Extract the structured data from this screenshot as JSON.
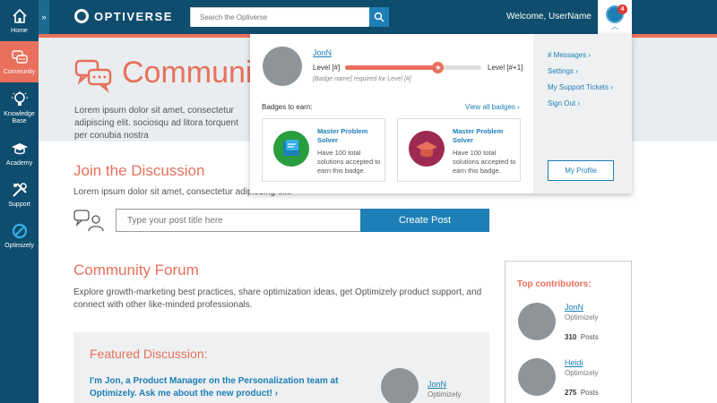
{
  "nav": {
    "items": [
      {
        "label": "Home",
        "icon": "home-icon"
      },
      {
        "label": "Community",
        "icon": "chat-bubbles-icon",
        "active": true
      },
      {
        "label": "Knowledge Base",
        "icon": "lightbulb-icon"
      },
      {
        "label": "Academy",
        "icon": "graduation-cap-icon"
      },
      {
        "label": "Support",
        "icon": "tools-icon"
      },
      {
        "label": "Optimizely",
        "icon": "optimizely-logo-icon"
      }
    ],
    "collapse_glyph": "»"
  },
  "header": {
    "logo_text": "OPTIVERSE",
    "search_placeholder": "Search the Optiverse",
    "welcome": "Welcome, UserName",
    "notification_count": "4"
  },
  "hero": {
    "title": "Community",
    "text": "Lorem ipsum dolor sit amet, consectetur adipiscing elit. sociosqu ad litora torquent per conubia nostra"
  },
  "join": {
    "title": "Join the Discussion",
    "text": "Lorem ipsum dolor sit amet, consectetur adipiscing elit.",
    "post_placeholder": "Type your post title here",
    "post_button": "Create Post"
  },
  "forum": {
    "title": "Community Forum",
    "text": "Explore growth-marketing best practices, share optimization ideas, get Optimizely product support, and connect with other like-minded professionals."
  },
  "featured": {
    "title": "Featured Discussion:",
    "link": "I'm Jon, a Product Manager on the Personalization team at Optimizely. Ask me about the new product! ›",
    "user": "JonN",
    "org": "Optimizely"
  },
  "contributors": {
    "title": "Top contributors:",
    "posts_label": "Posts",
    "items": [
      {
        "name": "JonN",
        "org": "Optimizely",
        "posts": "310"
      },
      {
        "name": "Heidi",
        "org": "Optimizely",
        "posts": "275"
      }
    ]
  },
  "dropdown": {
    "username": "JonN",
    "level_current": "Level [#]",
    "level_next": "Level [#+1]",
    "level_progress": 0.68,
    "level_requirement": "[Badge name] required for Level [#]",
    "badges_label": "Badges to earn:",
    "view_all": "View all badges ›",
    "badges": [
      {
        "name": "Master Problem Solver",
        "desc": "Have 100 total solutions accepted to earn this badge.",
        "color": "#2a9d3f",
        "icon": "document-badge-icon"
      },
      {
        "name": "Master Problem Solver",
        "desc": "Have 100 total solutions accepted to earn this badge.",
        "color": "#9c2a52",
        "icon": "graduation-cap-badge-icon"
      }
    ],
    "links": [
      "# Messages ›",
      "Settings ›",
      "My Support Tickets ›",
      "Sign Out ›"
    ],
    "profile_button": "My Profile"
  },
  "colors": {
    "nav_bg": "#0f4d6e",
    "accent": "#e8705c",
    "link": "#1d7fb5"
  }
}
